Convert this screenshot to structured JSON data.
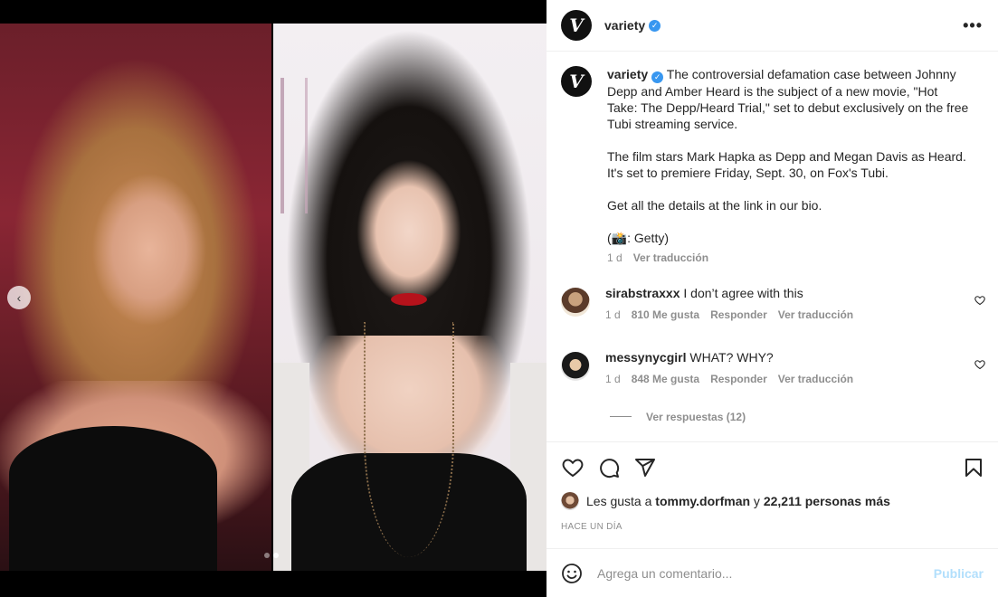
{
  "post": {
    "account": "variety",
    "logo_glyph": "V",
    "verified_icon": "verified-badge-icon",
    "more_icon": "more-options-icon",
    "more_glyph": "•••"
  },
  "media": {
    "carousel_prev_glyph": "‹",
    "slide_count": 2,
    "active_slide": 1
  },
  "caption": {
    "username": "variety",
    "paragraphs": [
      "The controversial defamation case between Johnny Depp and Amber Heard is the subject of a new movie, \"Hot Take: The Depp/Heard Trial,\" set to debut exclusively on the free Tubi streaming service.",
      "The film stars Mark Hapka as Depp and Megan Davis as Heard. It's set to premiere Friday, Sept. 30, on Fox's Tubi.",
      "Get all the details at the link in our bio.",
      "(📸: Getty)"
    ],
    "age": "1 d",
    "translate": "Ver traducción"
  },
  "comments": [
    {
      "username": "sirabstraxxx",
      "text": "I don’t agree with this",
      "age": "1 d",
      "likes": "810 Me gusta",
      "reply": "Responder",
      "translate": "Ver traducción"
    },
    {
      "username": "messynycgirl",
      "text": "WHAT? WHY?",
      "age": "1 d",
      "likes": "848 Me gusta",
      "reply": "Responder",
      "translate": "Ver traducción",
      "view_replies": "Ver respuestas (12)"
    }
  ],
  "likes": {
    "prefix": "Les gusta a",
    "user": "tommy.dorfman",
    "connector": "y",
    "others": "22,211 personas más"
  },
  "timestamp": "Hace un día",
  "add_comment": {
    "placeholder": "Agrega un comentario...",
    "publish": "Publicar"
  },
  "colors": {
    "verified": "#3897f0",
    "publish_disabled": "#b2dffc",
    "secondary_text": "#8e8e8e"
  }
}
